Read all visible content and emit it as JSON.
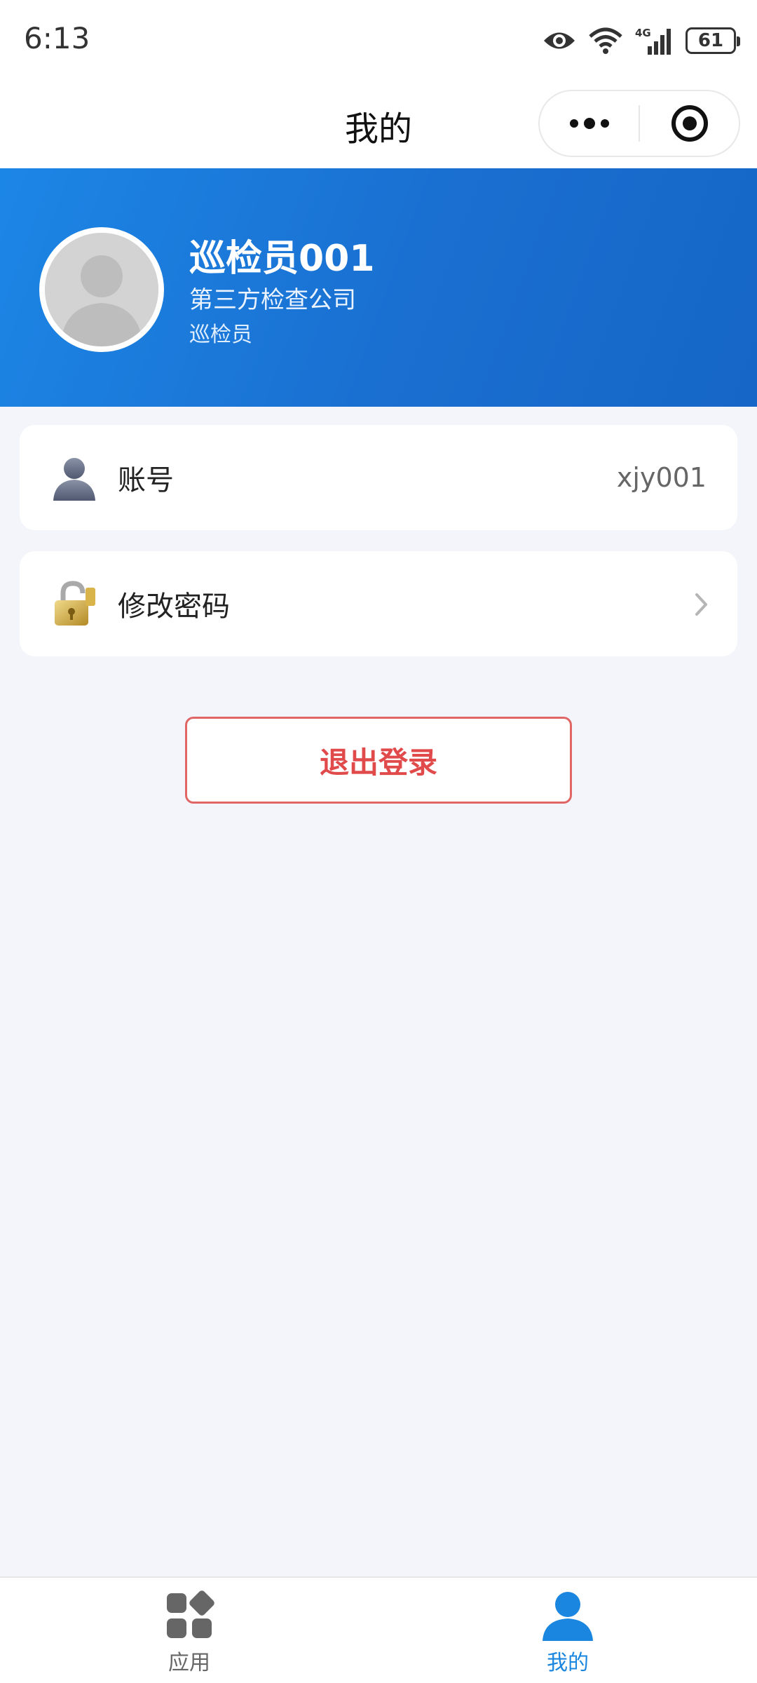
{
  "status_bar": {
    "time": "6:13",
    "battery": "61",
    "icons": [
      "eye-icon",
      "wifi-icon",
      "signal-4g-icon",
      "battery-icon"
    ]
  },
  "nav": {
    "title": "我的",
    "icons": [
      "more-dots-icon",
      "target-circle-icon"
    ]
  },
  "profile": {
    "name": "巡检员001",
    "company": "第三方检查公司",
    "role": "巡检员",
    "avatar_icon": "default-avatar-icon"
  },
  "account_card": {
    "label": "账号",
    "value": "xjy001",
    "icon": "user-silhouette-icon"
  },
  "password_card": {
    "label": "修改密码",
    "icon": "padlock-icon",
    "chevron": "chevron-right-icon"
  },
  "logout": {
    "label": "退出登录"
  },
  "tabs": [
    {
      "label": "应用",
      "icon": "apps-grid-icon",
      "active": false
    },
    {
      "label": "我的",
      "icon": "person-icon",
      "active": true
    }
  ],
  "colors": {
    "header_gradient_start": "#1c86e6",
    "header_gradient_end": "#1566c6",
    "logout_red": "#e14a4a",
    "tab_active": "#1a86e0",
    "tab_inactive": "#666666",
    "page_bg": "#f4f5fa"
  }
}
